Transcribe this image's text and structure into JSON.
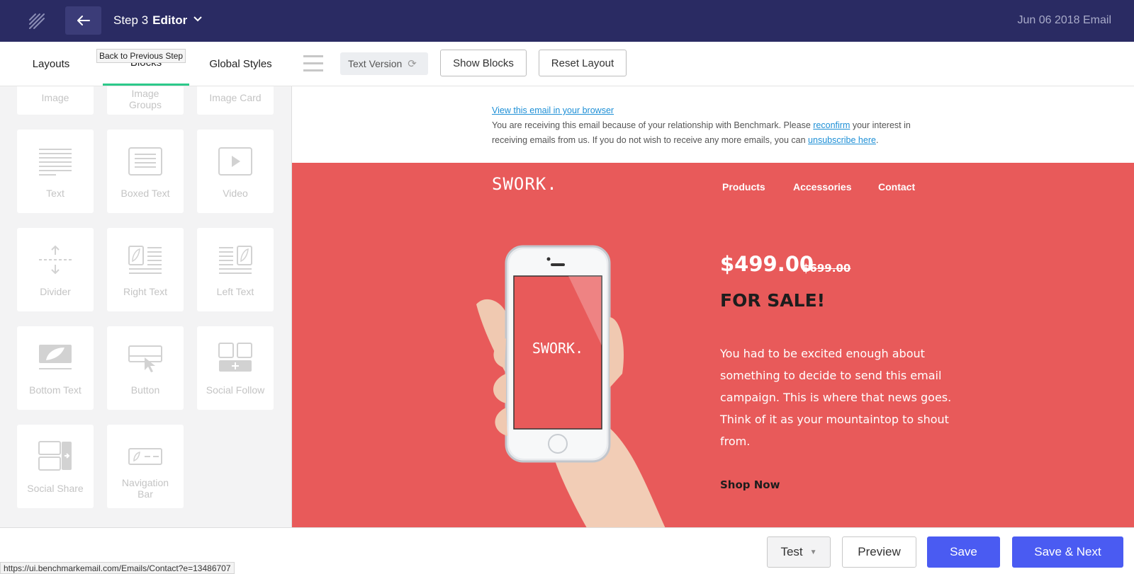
{
  "header": {
    "step_label": "Step 3",
    "editor_label": "Editor",
    "document_title": "Jun 06 2018 Email",
    "back_tooltip": "Back to Previous Step"
  },
  "toolbar": {
    "tabs": [
      "Layouts",
      "Blocks",
      "Global Styles"
    ],
    "active_tab": "Blocks",
    "text_version": "Text Version",
    "show_blocks": "Show Blocks",
    "reset_layout": "Reset Layout"
  },
  "sidebar": {
    "blocks": [
      {
        "label": "Image",
        "icon": "image-icon"
      },
      {
        "label": "Image Groups",
        "icon": "image-groups-icon"
      },
      {
        "label": "Image Card",
        "icon": "image-card-icon"
      },
      {
        "label": "Text",
        "icon": "text-icon"
      },
      {
        "label": "Boxed Text",
        "icon": "boxed-text-icon"
      },
      {
        "label": "Video",
        "icon": "video-icon"
      },
      {
        "label": "Divider",
        "icon": "divider-icon"
      },
      {
        "label": "Right Text",
        "icon": "right-text-icon"
      },
      {
        "label": "Left Text",
        "icon": "left-text-icon"
      },
      {
        "label": "Bottom Text",
        "icon": "bottom-text-icon"
      },
      {
        "label": "Button",
        "icon": "button-icon"
      },
      {
        "label": "Social Follow",
        "icon": "social-follow-icon"
      },
      {
        "label": "Social Share",
        "icon": "social-share-icon"
      },
      {
        "label": "Navigation Bar",
        "icon": "navigation-bar-icon"
      }
    ]
  },
  "email": {
    "view_in_browser": "View this email in your browser",
    "notice_prefix": "You are receiving this email because of your relationship with Benchmark. Please",
    "reconfirm_link": "reconfirm",
    "notice_middle": "your interest in receiving emails from us. If you do not wish to receive any more emails, you can",
    "unsubscribe_link": "unsubscribe here",
    "notice_suffix": ".",
    "logo": "SWORK.",
    "nav": [
      "Products",
      "Accessories",
      "Contact"
    ],
    "phone_screen_text": "SWORK.",
    "price": "$499.00",
    "old_price": "$699.00",
    "headline": "FOR SALE!",
    "body": "You had to be excited enough about something to decide to send this email campaign. This is where that news goes. Think of it as your mountaintop to shout from.",
    "cta": "Shop Now"
  },
  "footer": {
    "test": "Test",
    "preview": "Preview",
    "save": "Save",
    "save_next": "Save & Next"
  },
  "status_url": "https://ui.benchmarkemail.com/Emails/Contact?e=13486707",
  "colors": {
    "header_bg": "#2a2b63",
    "email_bg": "#e85a5a",
    "primary_button": "#4a5bf2",
    "active_tab_underline": "#2cc98a",
    "link": "#1d8fd6"
  }
}
